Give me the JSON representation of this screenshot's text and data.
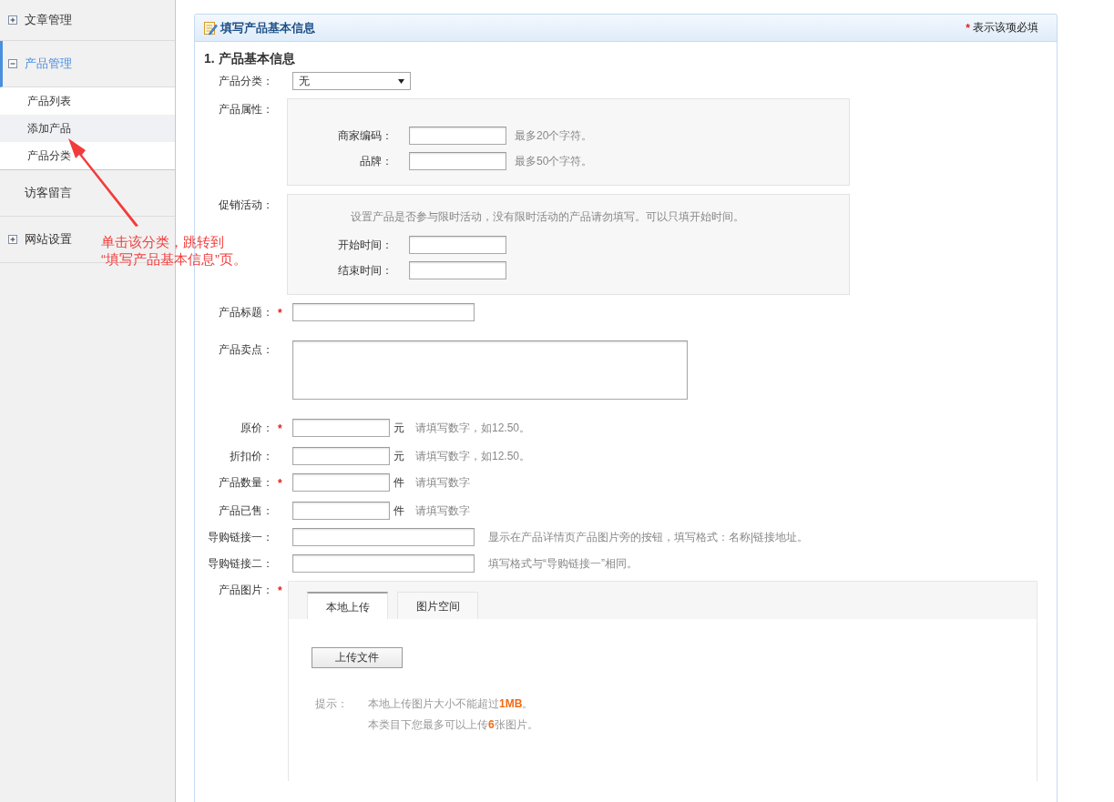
{
  "sidebar": {
    "items": [
      {
        "label": "文章管理",
        "kind": "group",
        "expanded": false,
        "selected": false
      },
      {
        "label": "产品管理",
        "kind": "group",
        "expanded": true,
        "selected": true,
        "children": [
          {
            "label": "产品列表",
            "selected": false
          },
          {
            "label": "添加产品",
            "selected": true
          },
          {
            "label": "产品分类",
            "selected": false
          }
        ]
      },
      {
        "label": "访客留言",
        "kind": "link",
        "selected": false
      },
      {
        "label": "网站设置",
        "kind": "group",
        "expanded": false,
        "selected": false
      }
    ]
  },
  "annotation": {
    "lines": [
      "单击该分类，跳转到",
      "“填写产品基本信息”页。"
    ]
  },
  "required_mark": "*",
  "panel": {
    "title": "填写产品基本信息",
    "required_note": "表示该项必填",
    "section_title": "1. 产品基本信息",
    "rows": [
      {
        "kind": "select",
        "label": "产品分类：",
        "value": "无"
      },
      {
        "kind": "group",
        "label": "产品属性：",
        "fields": [
          {
            "label": "商家编码：",
            "hint": "最多20个字符。"
          },
          {
            "label": "品牌：",
            "hint": "最多50个字符。"
          }
        ]
      },
      {
        "kind": "group",
        "label": "促销活动：",
        "note": "设置产品是否参与限时活动，没有限时活动的产品请勿填写。可以只填开始时间。",
        "fields": [
          {
            "label": "开始时间："
          },
          {
            "label": "结束时间："
          }
        ]
      },
      {
        "kind": "text",
        "label": "产品标题：",
        "required": true
      },
      {
        "kind": "textarea",
        "label": "产品卖点："
      },
      {
        "kind": "short",
        "label": "原价：",
        "required": true,
        "unit": "元",
        "hint": "请填写数字，如12.50。"
      },
      {
        "kind": "short",
        "label": "折扣价：",
        "unit": "元",
        "hint": "请填写数字，如12.50。"
      },
      {
        "kind": "short",
        "label": "产品数量：",
        "required": true,
        "unit": "件",
        "hint": "请填写数字"
      },
      {
        "kind": "short",
        "label": "产品已售：",
        "unit": "件",
        "hint": "请填写数字"
      },
      {
        "kind": "text",
        "label": "导购链接一：",
        "hint": "显示在产品详情页产品图片旁的按钮，填写格式：名称|链接地址。"
      },
      {
        "kind": "text",
        "label": "导购链接二：",
        "hint": "填写格式与“导购链接一”相同。"
      },
      {
        "kind": "upload",
        "label": "产品图片：",
        "required": true,
        "tabs": [
          {
            "label": "本地上传",
            "selected": true
          },
          {
            "label": "图片空间",
            "selected": false
          }
        ],
        "button": "上传文件",
        "tip_label": "提示：",
        "tips": [
          "本地上传图片大小不能超过**1MB**。",
          "本类目下您最多可以上传**6**张图片。"
        ]
      }
    ]
  }
}
